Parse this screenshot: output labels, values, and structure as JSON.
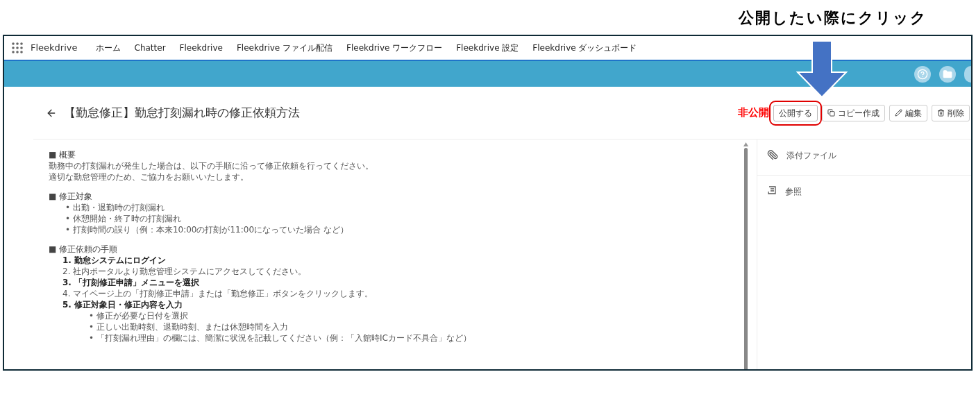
{
  "annotation": {
    "callout": "公開したい際にクリック"
  },
  "nav": {
    "app_name": "Fleekdrive",
    "items": [
      "ホーム",
      "Chatter",
      "Fleekdrive",
      "Fleekdrive ファイル配信",
      "Fleekdrive ワークフロー",
      "Fleekdrive 設定",
      "Fleekdrive ダッシュボード"
    ]
  },
  "header": {
    "title": "【勤怠修正】勤怠打刻漏れ時の修正依頼方法",
    "status": "非公開",
    "buttons": [
      {
        "kind": "publish",
        "label": "公開する",
        "highlighted": true
      },
      {
        "kind": "copy",
        "label": "コピー作成",
        "highlighted": false
      },
      {
        "kind": "edit",
        "label": "編集",
        "highlighted": false
      },
      {
        "kind": "delete",
        "label": "削除",
        "highlighted": false
      }
    ]
  },
  "article": [
    {
      "kind": "paragraph",
      "heading": "■ 概要",
      "lines": [
        "勤務中の打刻漏れが発生した場合は、以下の手順に沿って修正依頼を行ってください。",
        "適切な勤怠管理のため、ご協力をお願いいたします。"
      ]
    },
    {
      "kind": "bullets",
      "heading": "■ 修正対象",
      "lines": [
        "• 出勤・退勤時の打刻漏れ",
        "• 休憩開始・終了時の打刻漏れ",
        "• 打刻時間の誤り（例：本来10:00の打刻が11:00になっていた場合 など）"
      ]
    },
    {
      "kind": "steps",
      "heading": "■ 修正依頼の手順",
      "steps": [
        {
          "number": "1.",
          "text": "勤怠システムにログイン",
          "bold": true
        },
        {
          "number": "2.",
          "text": "社内ポータルより勤怠管理システムにアクセスしてください。",
          "bold": false
        },
        {
          "number": "3.",
          "text": "「打刻修正申請」メニューを選択",
          "bold": true
        },
        {
          "number": "4.",
          "text": "マイページ上の「打刻修正申請」または「勤怠修正」ボタンをクリックします。",
          "bold": false
        },
        {
          "number": "5.",
          "text": "修正対象日・修正内容を入力",
          "bold": true,
          "children": [
            "• 修正が必要な日付を選択",
            "• 正しい出勤時刻、退勤時刻、または休憩時間を入力",
            "• 「打刻漏れ理由」の欄には、簡潔に状況を記載してください（例：「入館時ICカード不具合」など）"
          ]
        }
      ]
    }
  ],
  "sidebar": {
    "items": [
      {
        "kind": "attachment",
        "label": "添付ファイル"
      },
      {
        "kind": "reference",
        "label": "参照"
      }
    ]
  }
}
